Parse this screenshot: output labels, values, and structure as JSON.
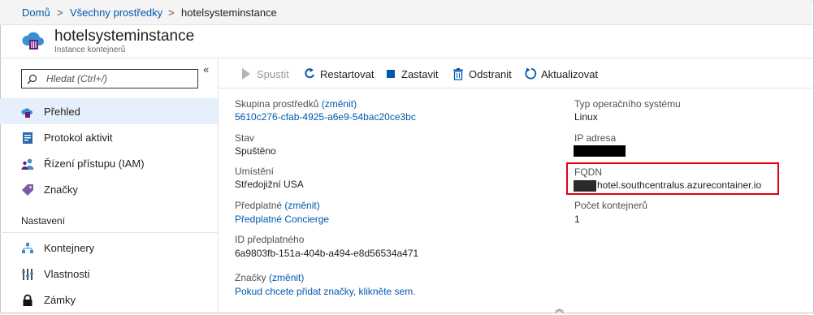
{
  "breadcrumb": {
    "items": [
      "Domů",
      "Všechny prostředky",
      "hotelsysteminstance"
    ],
    "separator": ">"
  },
  "resource": {
    "title": "hotelsysteminstance",
    "subtitle": "Instance kontejnerů"
  },
  "sidebar": {
    "collapse_glyph": "«",
    "search": {
      "placeholder": "Hledat (Ctrl+/)",
      "value": ""
    },
    "items": [
      {
        "label": "Přehled",
        "icon": "container-instance-icon",
        "active": true
      },
      {
        "label": "Protokol aktivit",
        "icon": "activity-log-icon"
      },
      {
        "label": "Řízení přístupu (IAM)",
        "icon": "people-icon"
      },
      {
        "label": "Značky",
        "icon": "tag-icon"
      }
    ],
    "section_title": "Nastavení",
    "settings_items": [
      {
        "label": "Kontejnery",
        "icon": "containers-icon"
      },
      {
        "label": "Vlastnosti",
        "icon": "properties-icon"
      },
      {
        "label": "Zámky",
        "icon": "lock-icon"
      }
    ]
  },
  "toolbar": {
    "start": "Spustit",
    "restart": "Restartovat",
    "stop": "Zastavit",
    "delete": "Odstranit",
    "refresh": "Aktualizovat"
  },
  "essentials": {
    "resource_group_label": "Skupina prostředků",
    "change_link": "(změnit)",
    "resource_group_value": "5610c276-cfab-4925-a6e9-54bac20ce3bc",
    "status_label": "Stav",
    "status_value": "Spuštěno",
    "location_label": "Umístění",
    "location_value": "Středojižní USA",
    "subscription_label": "Předplatné",
    "subscription_value": "Předplatné Concierge",
    "subscription_id_label": "ID předplatného",
    "subscription_id_value": "6a9803fb-151a-404b-a494-e8d56534a471",
    "tags_label": "Značky",
    "tags_value": "Pokud chcete přidat značky, klikněte sem.",
    "os_label": "Typ operačního systému",
    "os_value": "Linux",
    "ip_label": "IP adresa",
    "fqdn_label": "FQDN",
    "fqdn_value": "hotel.southcentralus.azurecontainer.io",
    "container_count_label": "Počet kontejnerů",
    "container_count_value": "1"
  },
  "colors": {
    "accent": "#0058ad",
    "highlight": "#e3000f",
    "active_bg": "#e6f0fa"
  },
  "expand_glyph": "︽"
}
